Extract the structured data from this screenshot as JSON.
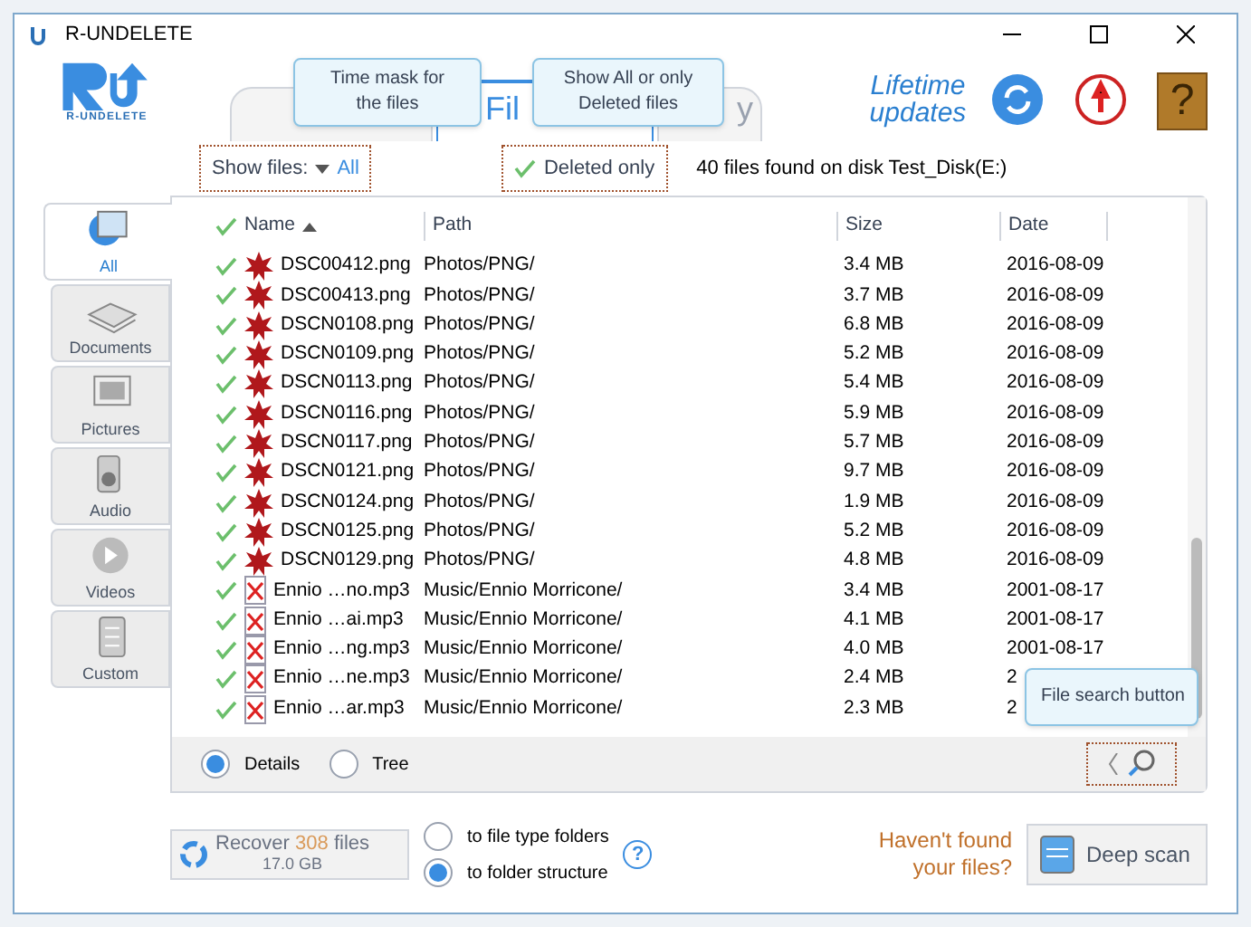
{
  "window": {
    "title": "R-UNDELETE"
  },
  "logo": {
    "text": "R-UNDELETE"
  },
  "tabs": [
    {
      "selected": false
    },
    {
      "label": "Fil",
      "selected": true
    },
    {
      "label": "y",
      "selected": false
    }
  ],
  "help_button": "?",
  "tooltips": [
    {
      "text": "Time mask for the files"
    },
    {
      "text": "Show All or only Deleted files"
    },
    {
      "text": "File search button"
    }
  ],
  "lifetime_updates": "Lifetime updates",
  "filter": {
    "label": "Show files:",
    "value": "All"
  },
  "deleted_only": {
    "label": "Deleted only",
    "checked": true
  },
  "status": "40 files found on disk Test_Disk(E:)",
  "categories": [
    {
      "label": "All",
      "selected": true
    },
    {
      "label": "Documents",
      "selected": false
    },
    {
      "label": "Pictures",
      "selected": false
    },
    {
      "label": "Audio",
      "selected": false
    },
    {
      "label": "Videos",
      "selected": false
    },
    {
      "label": "Custom",
      "selected": false
    }
  ],
  "table": {
    "header_checked": true,
    "columns": [
      "Name",
      "Path",
      "Size",
      "Date"
    ],
    "rows": [
      {
        "kind": "image",
        "checked": true,
        "name": "DSC00412.png",
        "path": "Photos/PNG/",
        "size": "3.4 MB",
        "date": "2016-08-09"
      },
      {
        "kind": "image",
        "checked": true,
        "name": "DSC00413.png",
        "path": "Photos/PNG/",
        "size": "3.7 MB",
        "date": "2016-08-09"
      },
      {
        "kind": "image",
        "checked": true,
        "name": "DSCN0108.png",
        "path": "Photos/PNG/",
        "size": "6.8 MB",
        "date": "2016-08-09"
      },
      {
        "kind": "image",
        "checked": true,
        "name": "DSCN0109.png",
        "path": "Photos/PNG/",
        "size": "5.2 MB",
        "date": "2016-08-09"
      },
      {
        "kind": "image",
        "checked": true,
        "name": "DSCN0113.png",
        "path": "Photos/PNG/",
        "size": "5.4 MB",
        "date": "2016-08-09"
      },
      {
        "kind": "image",
        "checked": true,
        "name": "DSCN0116.png",
        "path": "Photos/PNG/",
        "size": "5.9 MB",
        "date": "2016-08-09"
      },
      {
        "kind": "image",
        "checked": true,
        "name": "DSCN0117.png",
        "path": "Photos/PNG/",
        "size": "5.7 MB",
        "date": "2016-08-09"
      },
      {
        "kind": "image",
        "checked": true,
        "name": "DSCN0121.png",
        "path": "Photos/PNG/",
        "size": "9.7 MB",
        "date": "2016-08-09"
      },
      {
        "kind": "image",
        "checked": true,
        "name": "DSCN0124.png",
        "path": "Photos/PNG/",
        "size": "1.9 MB",
        "date": "2016-08-09"
      },
      {
        "kind": "image",
        "checked": true,
        "name": "DSCN0125.png",
        "path": "Photos/PNG/",
        "size": "5.2 MB",
        "date": "2016-08-09"
      },
      {
        "kind": "image",
        "checked": true,
        "name": "DSCN0129.png",
        "path": "Photos/PNG/",
        "size": "4.8 MB",
        "date": "2016-08-09"
      },
      {
        "kind": "audio",
        "checked": true,
        "name": "Ennio …no.mp3",
        "path": "Music/Ennio Morricone/",
        "size": "3.4 MB",
        "date": "2001-08-17"
      },
      {
        "kind": "audio",
        "checked": true,
        "name": "Ennio …ai.mp3",
        "path": "Music/Ennio Morricone/",
        "size": "4.1 MB",
        "date": "2001-08-17"
      },
      {
        "kind": "audio",
        "checked": true,
        "name": "Ennio …ng.mp3",
        "path": "Music/Ennio Morricone/",
        "size": "4.0 MB",
        "date": "2001-08-17"
      },
      {
        "kind": "audio",
        "checked": true,
        "name": "Ennio …ne.mp3",
        "path": "Music/Ennio Morricone/",
        "size": "2.4 MB",
        "date": "2"
      },
      {
        "kind": "audio",
        "checked": true,
        "name": "Ennio …ar.mp3",
        "path": "Music/Ennio Morricone/",
        "size": "2.3 MB",
        "date": "2"
      }
    ]
  },
  "views": [
    {
      "label": "Details",
      "selected": true
    },
    {
      "label": "Tree",
      "selected": false
    }
  ],
  "recover": {
    "label": "Recover",
    "count": "308",
    "unit": "files",
    "size": "17.0 GB"
  },
  "destinations": [
    {
      "label": "to file type folders",
      "selected": false
    },
    {
      "label": "to folder structure",
      "selected": true
    }
  ],
  "options_help": "?",
  "help_text": "Haven't found your files?",
  "deep_scan": "Deep scan"
}
